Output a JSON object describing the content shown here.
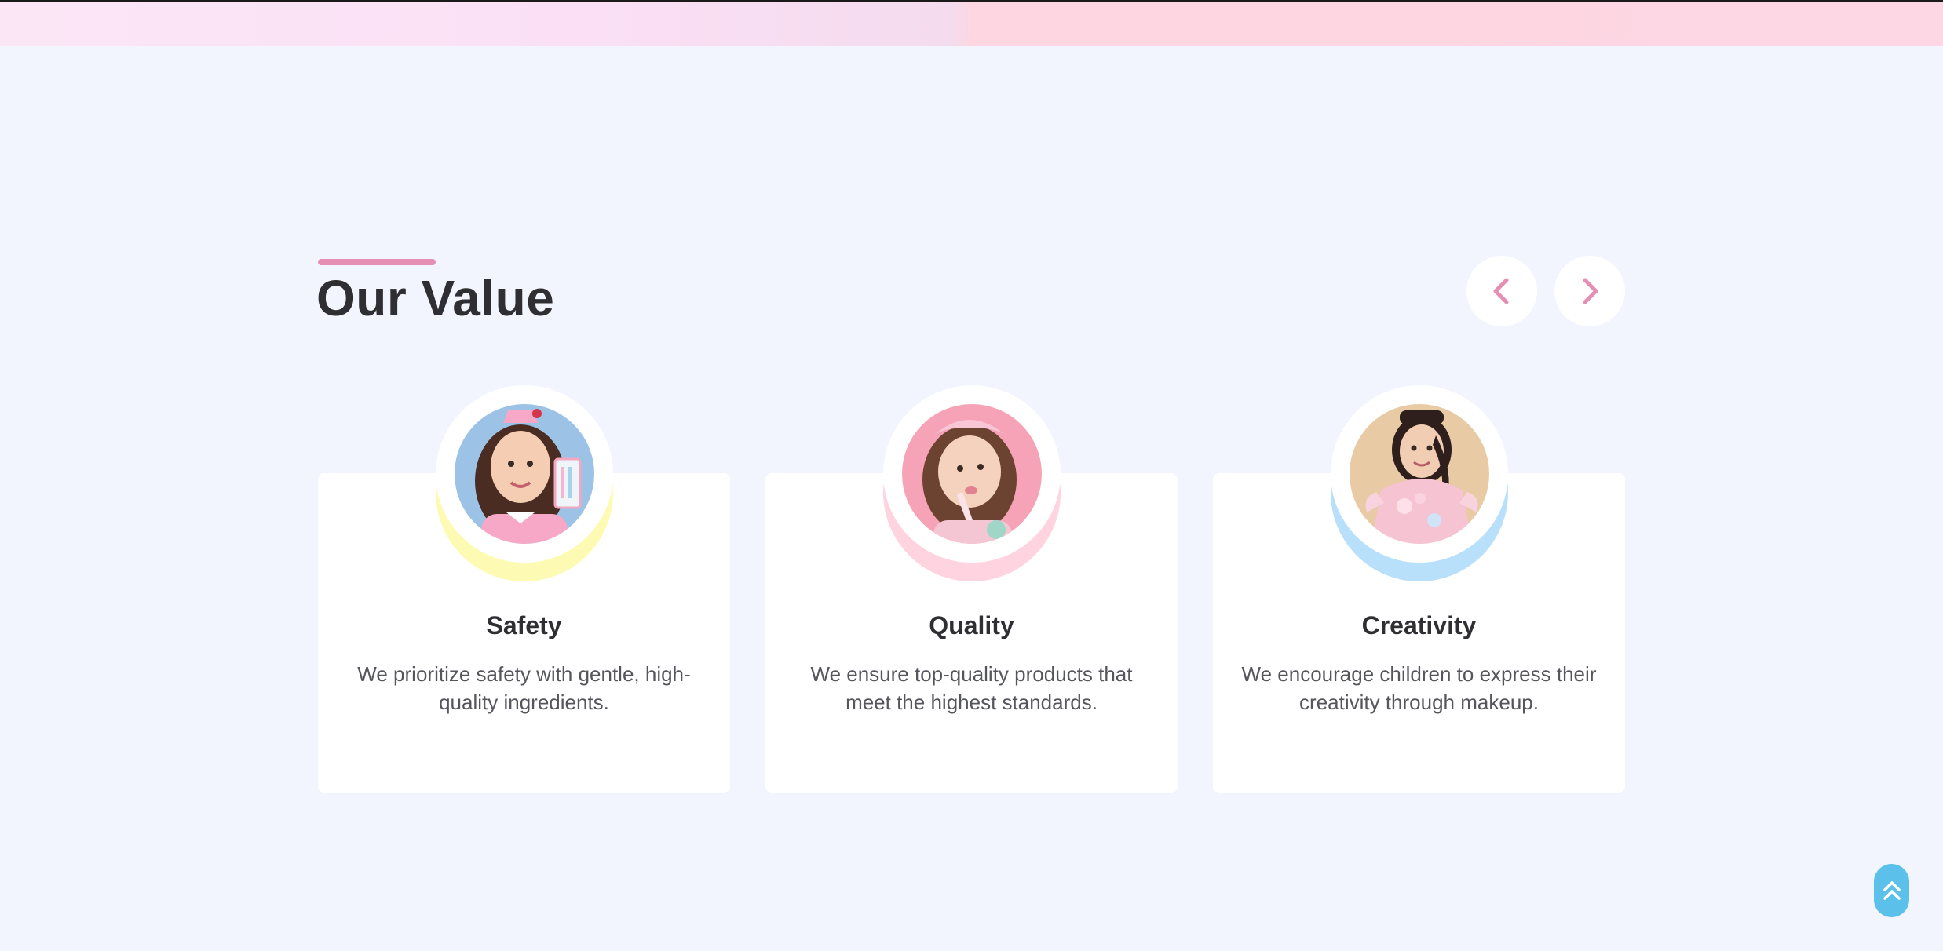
{
  "section": {
    "title": "Our Value"
  },
  "carousel": {
    "prev_icon": "chevron-left-icon",
    "next_icon": "chevron-right-icon"
  },
  "values": [
    {
      "title": "Safety",
      "text": "We prioritize safety with gentle, high-quality ingredients.",
      "accent_color": "#fdfbb3"
    },
    {
      "title": "Quality",
      "text": "We ensure top-quality products that meet the highest standards.",
      "accent_color": "#ffd3e0"
    },
    {
      "title": "Creativity",
      "text": "We encourage children to express their creativity through makeup.",
      "accent_color": "#b9e0fb"
    }
  ],
  "scroll_top": {
    "icon": "double-chevron-up-icon"
  },
  "colors": {
    "background": "#f2f5fe",
    "accent_pink": "#e58fb5",
    "scroll_button": "#5bc1ea"
  }
}
